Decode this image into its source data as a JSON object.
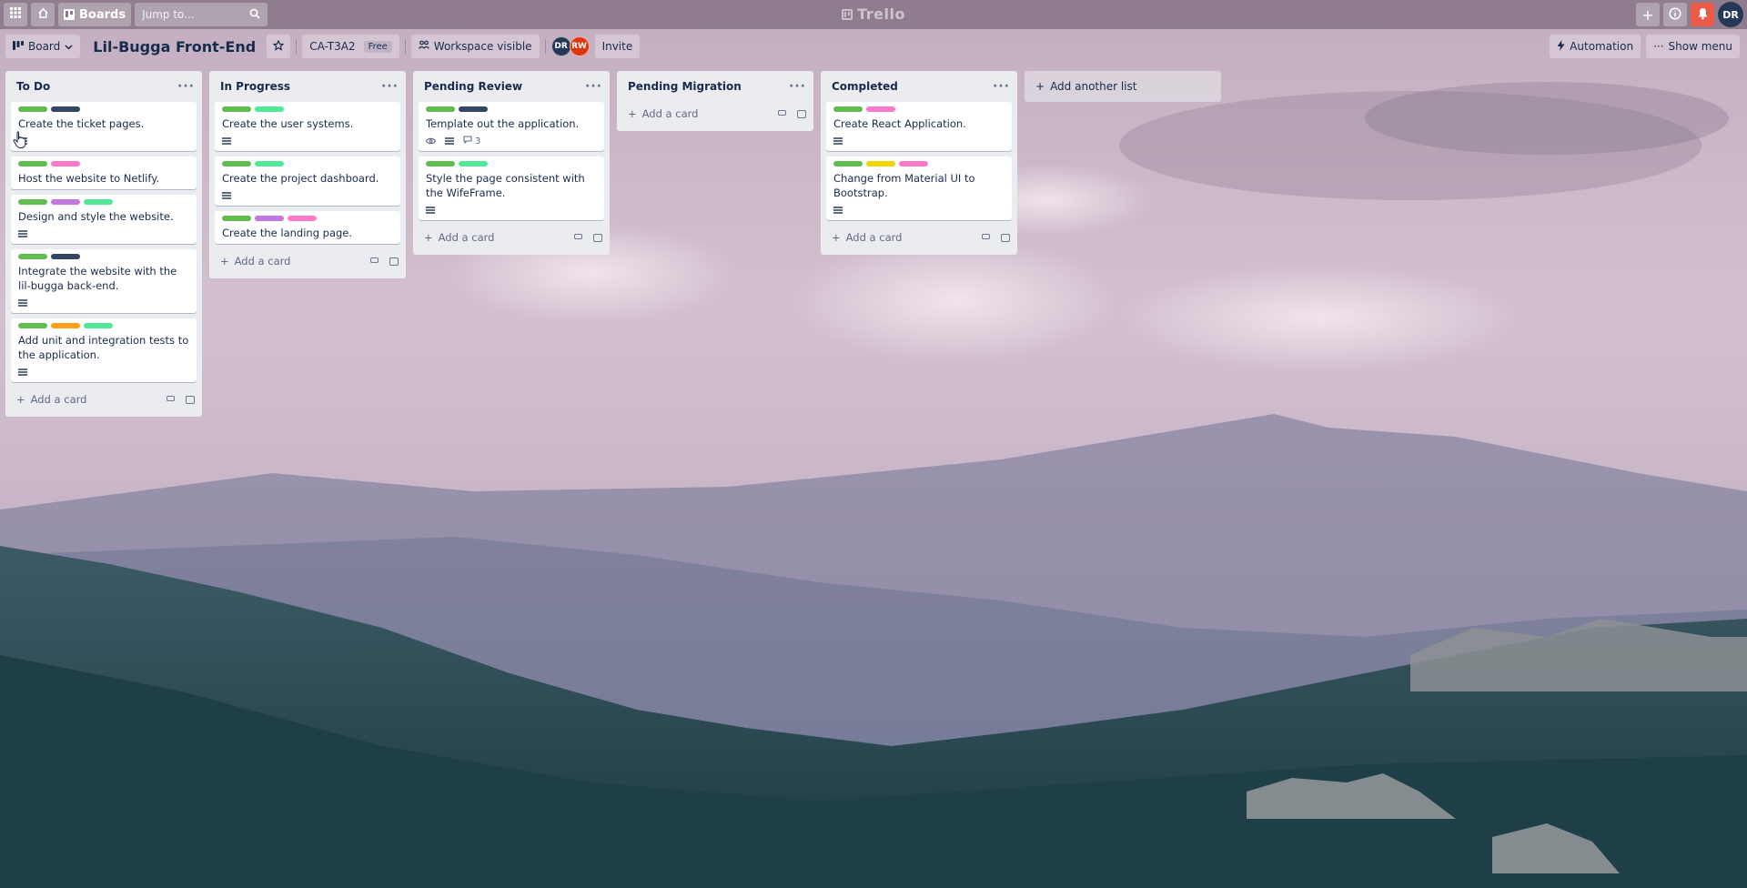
{
  "topnav": {
    "boards_label": "Boards",
    "search_placeholder": "Jump to...",
    "logo_text": "Trello",
    "user_initials": "DR"
  },
  "board": {
    "view_label": "Board",
    "title": "Lil-Bugga Front-End",
    "workspace_name": "CA-T3A2",
    "plan_badge": "Free",
    "visibility_label": "Workspace visible",
    "members": [
      "DR",
      "RW"
    ],
    "invite_label": "Invite",
    "automation_label": "Automation",
    "menu_label": "Show menu"
  },
  "label_colors": {
    "green": "#61bd4f",
    "navy": "#344563",
    "pink": "#ff78cb",
    "purple": "#c377e0",
    "mint": "#51e898",
    "orange": "#ff9f1a",
    "yellow": "#f2d600"
  },
  "add_card_label": "Add a card",
  "add_list_label": "Add another list",
  "lists": [
    {
      "name": "To Do",
      "cards": [
        {
          "title": "Create the ticket pages.",
          "labels": [
            "green",
            "navy"
          ],
          "description": true,
          "watch": false,
          "comments": ""
        },
        {
          "title": "Host the website to Netlify.",
          "labels": [
            "green",
            "pink"
          ],
          "description": false,
          "watch": false,
          "comments": ""
        },
        {
          "title": "Design and style the website.",
          "labels": [
            "green",
            "purple",
            "mint"
          ],
          "description": true,
          "watch": false,
          "comments": ""
        },
        {
          "title": "Integrate the website with the lil-bugga back-end.",
          "labels": [
            "green",
            "navy"
          ],
          "description": true,
          "watch": false,
          "comments": ""
        },
        {
          "title": "Add unit and integration tests to the application.",
          "labels": [
            "green",
            "orange",
            "mint"
          ],
          "description": true,
          "watch": false,
          "comments": ""
        }
      ]
    },
    {
      "name": "In Progress",
      "cards": [
        {
          "title": "Create the user systems.",
          "labels": [
            "green",
            "mint"
          ],
          "description": true,
          "watch": false,
          "comments": ""
        },
        {
          "title": "Create the project dashboard.",
          "labels": [
            "green",
            "mint"
          ],
          "description": true,
          "watch": false,
          "comments": ""
        },
        {
          "title": "Create the landing page.",
          "labels": [
            "green",
            "purple",
            "pink"
          ],
          "description": false,
          "watch": false,
          "comments": ""
        }
      ]
    },
    {
      "name": "Pending Review",
      "cards": [
        {
          "title": "Template out the application.",
          "labels": [
            "green",
            "navy"
          ],
          "description": true,
          "watch": true,
          "comments": "3"
        },
        {
          "title": "Style the page consistent with the WifeFrame.",
          "labels": [
            "green",
            "mint"
          ],
          "description": true,
          "watch": false,
          "comments": ""
        }
      ]
    },
    {
      "name": "Pending Migration",
      "cards": []
    },
    {
      "name": "Completed",
      "cards": [
        {
          "title": "Create React Application.",
          "labels": [
            "green",
            "pink"
          ],
          "description": true,
          "watch": false,
          "comments": ""
        },
        {
          "title": "Change from Material UI to Bootstrap.",
          "labels": [
            "green",
            "yellow",
            "pink"
          ],
          "description": true,
          "watch": false,
          "comments": ""
        }
      ]
    }
  ]
}
